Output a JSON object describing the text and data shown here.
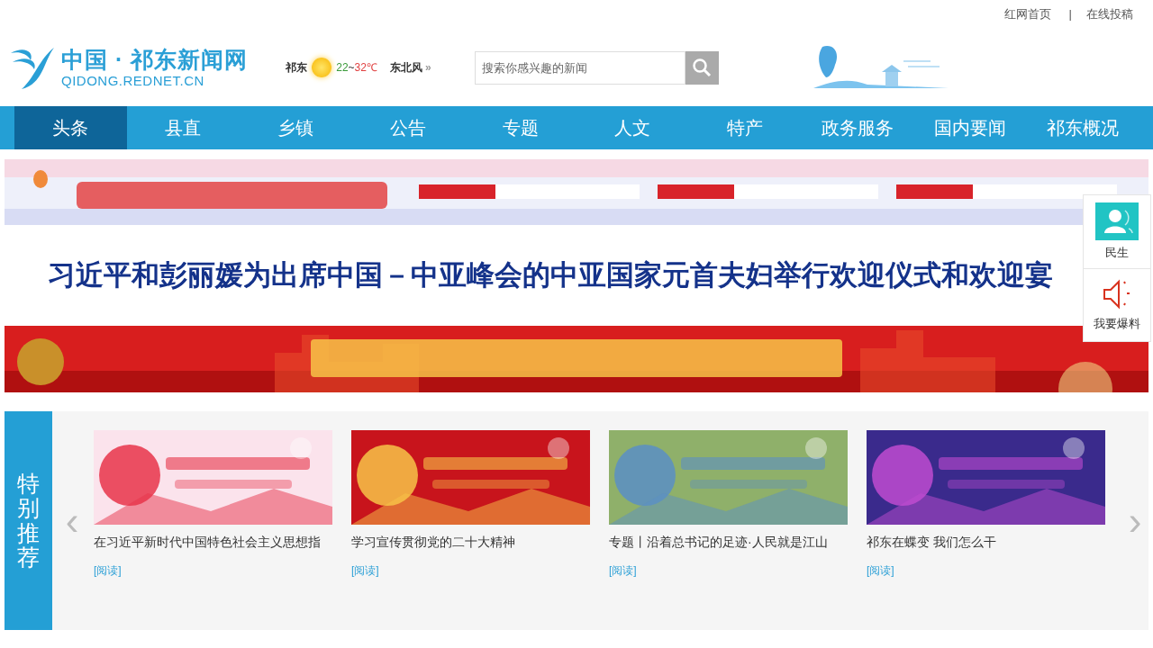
{
  "top_links": [
    "红网首页",
    "在线投稿"
  ],
  "top_separator": "|",
  "logo": {
    "title": "中国 · 祁东新闻网",
    "subtitle": "QIDONG.REDNET.CN"
  },
  "weather": {
    "city": "祁东",
    "low": "22",
    "sep": "~",
    "high": "32℃",
    "wind": "东北风",
    "more": "»"
  },
  "search": {
    "placeholder": "搜索你感兴趣的新闻"
  },
  "nav": [
    {
      "label": "头条",
      "selected": true
    },
    {
      "label": "县直",
      "selected": false
    },
    {
      "label": "乡镇",
      "selected": false
    },
    {
      "label": "公告",
      "selected": false
    },
    {
      "label": "专题",
      "selected": false
    },
    {
      "label": "人文",
      "selected": false
    },
    {
      "label": "特产",
      "selected": false
    },
    {
      "label": "政务服务",
      "selected": false
    },
    {
      "label": "国内要闻",
      "selected": false
    },
    {
      "label": "祁东概况",
      "selected": false
    }
  ],
  "headline": "习近平和彭丽媛为出席中国－中亚峰会的中亚国家元首夫妇举行欢迎仪式和欢迎宴",
  "float_panel": [
    "民生",
    "我要爆料"
  ],
  "featured": {
    "label": "特别推荐",
    "prev": "‹",
    "next": "›",
    "cards": [
      {
        "title": "在习近平新时代中国特色社会主义思想指",
        "link": "[阅读]"
      },
      {
        "title": "学习宣传贯彻党的二十大精神",
        "link": "[阅读]"
      },
      {
        "title": "专题丨沿着总书记的足迹·人民就是江山",
        "link": "[阅读]"
      },
      {
        "title": "祁东在蝶变 我们怎么干",
        "link": "[阅读]"
      }
    ]
  }
}
